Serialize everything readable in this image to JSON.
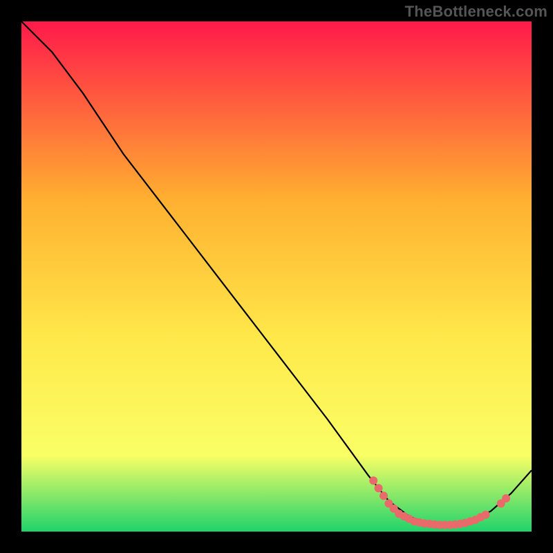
{
  "watermark": "TheBottleneck.com",
  "colors": {
    "frame_bg": "#000000",
    "curve_stroke": "#000000",
    "dot_fill": "#e86a6a",
    "gradient_top": "#ff1a4a",
    "gradient_mid1": "#ffb030",
    "gradient_mid2": "#ffe84a",
    "gradient_mid3": "#faff66",
    "gradient_bottom": "#1fd36b"
  },
  "chart_data": {
    "type": "line",
    "title": "",
    "xlabel": "",
    "ylabel": "",
    "xlim": [
      0,
      100
    ],
    "ylim": [
      0,
      100
    ],
    "grid": false,
    "legend": false,
    "curve": [
      {
        "x": 0,
        "y": 100
      },
      {
        "x": 6,
        "y": 94
      },
      {
        "x": 12,
        "y": 86
      },
      {
        "x": 20,
        "y": 74
      },
      {
        "x": 30,
        "y": 61
      },
      {
        "x": 40,
        "y": 48
      },
      {
        "x": 50,
        "y": 35
      },
      {
        "x": 60,
        "y": 22
      },
      {
        "x": 68,
        "y": 11
      },
      {
        "x": 72,
        "y": 6
      },
      {
        "x": 76,
        "y": 3
      },
      {
        "x": 80,
        "y": 1.5
      },
      {
        "x": 84,
        "y": 1.2
      },
      {
        "x": 88,
        "y": 2.0
      },
      {
        "x": 92,
        "y": 4.0
      },
      {
        "x": 96,
        "y": 7.5
      },
      {
        "x": 100,
        "y": 12
      }
    ],
    "dots": [
      {
        "x": 69,
        "y": 10
      },
      {
        "x": 70,
        "y": 8.5
      },
      {
        "x": 71,
        "y": 7
      },
      {
        "x": 72,
        "y": 5.5
      },
      {
        "x": 73,
        "y": 4.5
      },
      {
        "x": 74,
        "y": 3.5
      },
      {
        "x": 75,
        "y": 3
      },
      {
        "x": 76,
        "y": 2.5
      },
      {
        "x": 77,
        "y": 2
      },
      {
        "x": 78,
        "y": 1.8
      },
      {
        "x": 79,
        "y": 1.6
      },
      {
        "x": 80,
        "y": 1.5
      },
      {
        "x": 81,
        "y": 1.4
      },
      {
        "x": 82,
        "y": 1.3
      },
      {
        "x": 83,
        "y": 1.3
      },
      {
        "x": 84,
        "y": 1.3
      },
      {
        "x": 85,
        "y": 1.4
      },
      {
        "x": 86,
        "y": 1.5
      },
      {
        "x": 87,
        "y": 1.7
      },
      {
        "x": 88,
        "y": 2.0
      },
      {
        "x": 89,
        "y": 2.3
      },
      {
        "x": 90,
        "y": 2.8
      },
      {
        "x": 91,
        "y": 3.3
      },
      {
        "x": 94,
        "y": 5.5
      },
      {
        "x": 95,
        "y": 6.5
      }
    ]
  }
}
